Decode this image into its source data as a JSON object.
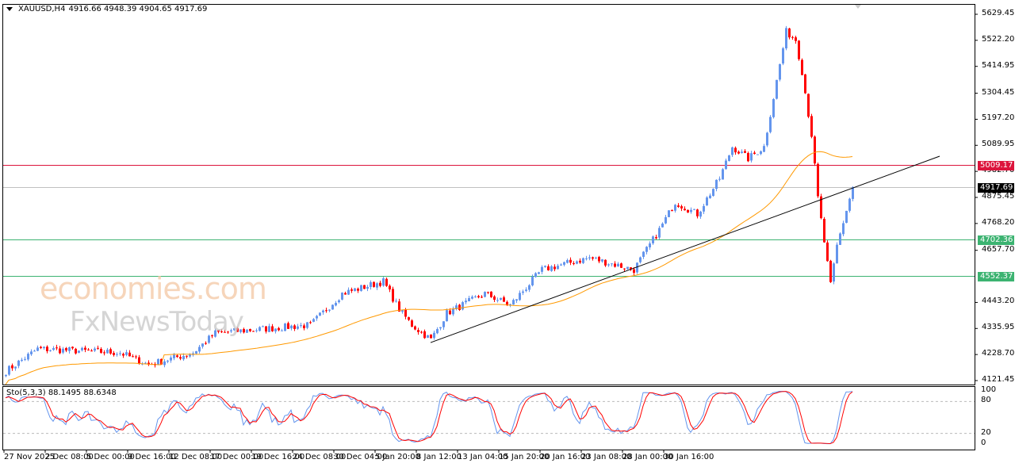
{
  "header": {
    "symbol": "XAUUSD,H4",
    "ohlc": "4916.66 4948.39 4904.65 4917.69"
  },
  "watermark": {
    "line1": "economies.com",
    "line2": "FxNewsToday"
  },
  "price_axis": [
    "5629.45",
    "5522.20",
    "5414.95",
    "5304.45",
    "5197.20",
    "5089.95",
    "4982.70",
    "4875.45",
    "4768.20",
    "4657.70",
    "4443.20",
    "4335.95",
    "4228.70",
    "4121.45"
  ],
  "levels": [
    {
      "label": "5009.17",
      "price": 5009.17,
      "color": "#dc143c"
    },
    {
      "label": "4917.69",
      "price": 4917.69,
      "color": "#000000",
      "line": "#c0c0c0"
    },
    {
      "label": "4702.36",
      "price": 4702.36,
      "color": "#3cb371"
    },
    {
      "label": "4552.37",
      "price": 4552.37,
      "color": "#3cb371"
    }
  ],
  "stochastic": {
    "label": "Sto(5,3,3) 88.1495 88.6348",
    "levels": [
      "100",
      "80",
      "20",
      "0"
    ]
  },
  "time_axis": [
    "27 Nov 2025",
    "2 Dec 08:00",
    "5 Dec 00:00",
    "9 Dec 16:00",
    "12 Dec 08:00",
    "17 Dec 00:00",
    "19 Dec 16:00",
    "24 Dec 08:00",
    "30 Dec 04:00",
    "5 Jan 20:00",
    "8 Jan 12:00",
    "13 Jan 04:00",
    "15 Jan 20:00",
    "20 Jan 16:00",
    "23 Jan 08:00",
    "28 Jan 00:00",
    "30 Jan 16:00"
  ],
  "chart_data": {
    "type": "candlestick",
    "title": "XAUUSD,H4",
    "ylim": [
      4121.45,
      5629.45
    ],
    "close_waypoints": [
      [
        0,
        4160
      ],
      [
        10,
        4252
      ],
      [
        36,
        4236
      ],
      [
        45,
        4187
      ],
      [
        59,
        4236
      ],
      [
        66,
        4317
      ],
      [
        81,
        4334
      ],
      [
        96,
        4350
      ],
      [
        106,
        4480
      ],
      [
        119,
        4530
      ],
      [
        124,
        4415
      ],
      [
        128,
        4350
      ],
      [
        134,
        4290
      ],
      [
        139,
        4399
      ],
      [
        151,
        4480
      ],
      [
        159,
        4432
      ],
      [
        169,
        4578
      ],
      [
        184,
        4627
      ],
      [
        198,
        4578
      ],
      [
        206,
        4742
      ],
      [
        211,
        4856
      ],
      [
        218,
        4807
      ],
      [
        225,
        4954
      ],
      [
        229,
        5084
      ],
      [
        234,
        5035
      ],
      [
        239,
        5084
      ],
      [
        246,
        5558
      ],
      [
        249,
        5525
      ],
      [
        251,
        5394
      ],
      [
        254,
        5133
      ],
      [
        256,
        4872
      ],
      [
        260,
        4513
      ],
      [
        262,
        4676
      ],
      [
        265,
        4823
      ],
      [
        267,
        4917.69
      ]
    ],
    "moving_average": {
      "period": 50,
      "color": "#ff9900"
    },
    "trendline": {
      "from": [
        134,
        4278
      ],
      "color": "#000000"
    }
  },
  "colors": {
    "bull": "#6495ed",
    "bear": "#ff0000",
    "ma": "#ff9900",
    "stoch_main": "#6495ed",
    "stoch_signal": "#ff0000"
  }
}
